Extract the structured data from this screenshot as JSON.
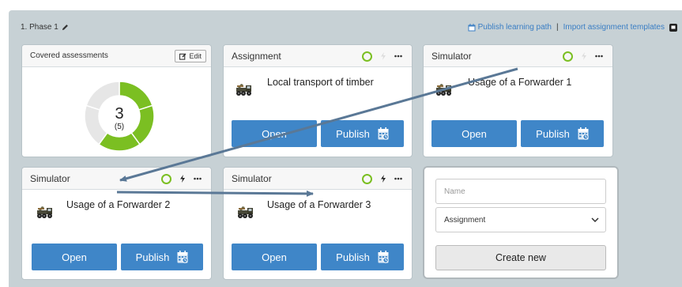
{
  "phase": {
    "title": "1. Phase 1"
  },
  "top_links": {
    "publish_path": "Publish learning path",
    "separator": "|",
    "import_templates": "Import assignment templates"
  },
  "covered": {
    "title": "Covered assessments",
    "edit_label": "Edit",
    "value": "3",
    "sub": "(5)",
    "fraction": 0.6
  },
  "cards": [
    {
      "header": "Assignment",
      "title": "Local transport of timber",
      "open": "Open",
      "publish": "Publish"
    },
    {
      "header": "Simulator",
      "title": "Usage of a Forwarder 1",
      "open": "Open",
      "publish": "Publish"
    },
    {
      "header": "Simulator",
      "title": "Usage of a Forwarder 2",
      "open": "Open",
      "publish": "Publish"
    },
    {
      "header": "Simulator",
      "title": "Usage of a Forwarder 3",
      "open": "Open",
      "publish": "Publish"
    }
  ],
  "form": {
    "name_placeholder": "Name",
    "type_value": "Assignment",
    "create_label": "Create new"
  },
  "colors": {
    "accent_blue": "#3f86c8",
    "status_green": "#7bbf22",
    "panel_bg": "#c7d1d5",
    "arrow": "#5a7896"
  }
}
